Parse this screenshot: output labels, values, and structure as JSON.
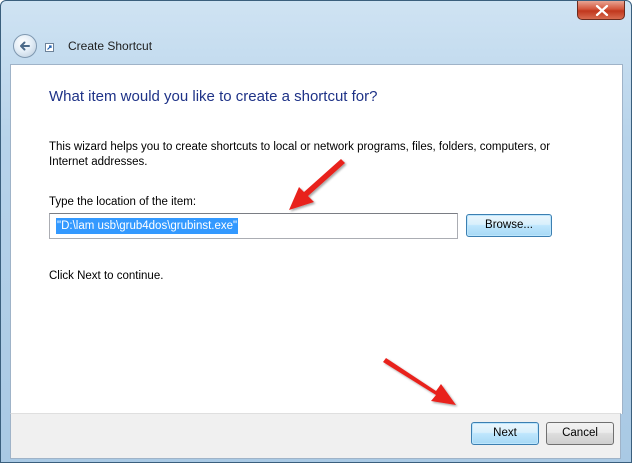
{
  "window": {
    "title": "Create Shortcut"
  },
  "wizard": {
    "heading": "What item would you like to create a shortcut for?",
    "description": "This wizard helps you to create shortcuts to local or network programs, files, folders, computers, or Internet addresses.",
    "location_label": "Type the location of the item:",
    "location_value": "\"D:\\lam usb\\grub4dos\\grubinst.exe\"",
    "browse_label": "Browse...",
    "continue_text": "Click Next to continue."
  },
  "footer": {
    "next_label": "Next",
    "cancel_label": "Cancel"
  },
  "annotations": {
    "arrow_color": "#e8231f"
  }
}
